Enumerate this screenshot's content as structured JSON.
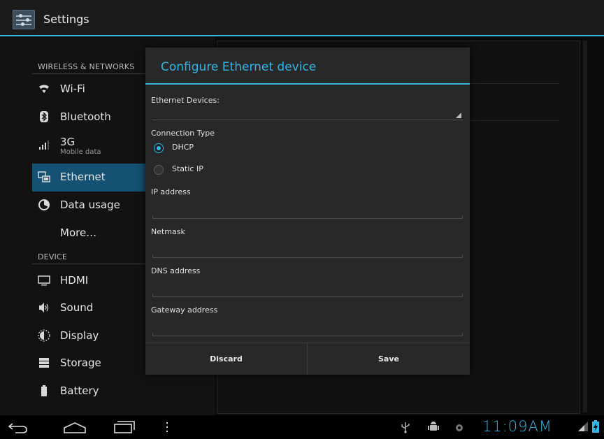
{
  "actionbar": {
    "title": "Settings",
    "icon": "settings-icon"
  },
  "sidebar": {
    "sections": [
      {
        "header": "WIRELESS & NETWORKS"
      },
      {
        "header": "DEVICE"
      }
    ],
    "items": [
      {
        "label": "Wi-Fi",
        "icon": "wifi-icon"
      },
      {
        "label": "Bluetooth",
        "icon": "bluetooth-icon"
      },
      {
        "label": "3G",
        "sub": "Mobile data",
        "icon": "signal-icon"
      },
      {
        "label": "Ethernet",
        "icon": "ethernet-icon",
        "active": true
      },
      {
        "label": "Data usage",
        "icon": "data-usage-icon"
      },
      {
        "label": "More…"
      },
      {
        "label": "HDMI",
        "icon": "monitor-icon"
      },
      {
        "label": "Sound",
        "icon": "speaker-icon"
      },
      {
        "label": "Display",
        "icon": "display-brightness-icon"
      },
      {
        "label": "Storage",
        "icon": "storage-icon"
      },
      {
        "label": "Battery",
        "icon": "battery-icon"
      }
    ]
  },
  "dialog": {
    "title": "Configure Ethernet device",
    "ethernet_devices_label": "Ethernet Devices:",
    "ethernet_devices_value": "",
    "connection_type_label": "Connection Type",
    "connection_options": [
      {
        "label": "DHCP",
        "selected": true
      },
      {
        "label": "Static IP",
        "selected": false
      }
    ],
    "fields": [
      {
        "label": "IP address",
        "value": ""
      },
      {
        "label": "Netmask",
        "value": ""
      },
      {
        "label": "DNS address",
        "value": ""
      },
      {
        "label": "Gateway address",
        "value": ""
      }
    ],
    "discard_label": "Discard",
    "save_label": "Save"
  },
  "systembar": {
    "time": "11:09AM",
    "accent": "#33b5e5"
  },
  "colors": {
    "accent": "#33b5e5",
    "selected_item": "#145172"
  }
}
